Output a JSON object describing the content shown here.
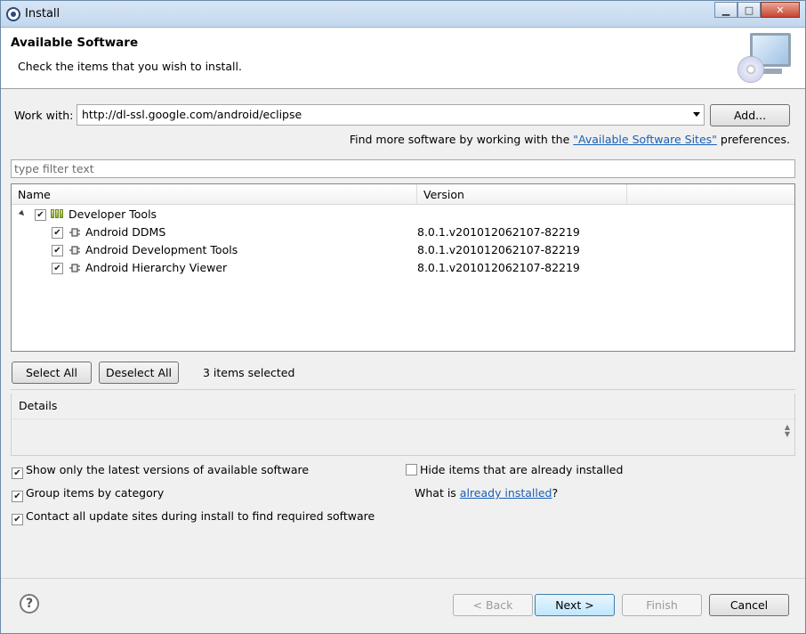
{
  "window": {
    "title": "Install"
  },
  "header": {
    "title": "Available Software",
    "subtitle": "Check the items that you wish to install."
  },
  "work_with": {
    "label": "Work with:",
    "value": "http://dl-ssl.google.com/android/eclipse",
    "add_button": "Add...",
    "hint_prefix": "Find more software by working with the ",
    "hint_link": "\"Available Software Sites\"",
    "hint_suffix": " preferences."
  },
  "filter": {
    "placeholder": "type filter text"
  },
  "table": {
    "columns": [
      "Name",
      "Version"
    ],
    "category": {
      "name": "Developer Tools",
      "checked": true
    },
    "items": [
      {
        "name": "Android DDMS",
        "version": "8.0.1.v201012062107-82219",
        "checked": true
      },
      {
        "name": "Android Development Tools",
        "version": "8.0.1.v201012062107-82219",
        "checked": true
      },
      {
        "name": "Android Hierarchy Viewer",
        "version": "8.0.1.v201012062107-82219",
        "checked": true
      }
    ]
  },
  "selection": {
    "select_all": "Select All",
    "deselect_all": "Deselect All",
    "status": "3 items selected"
  },
  "details": {
    "label": "Details"
  },
  "options": {
    "show_latest": {
      "label": "Show only the latest versions of available software",
      "checked": true
    },
    "group_by_category": {
      "label": "Group items by category",
      "checked": true
    },
    "contact_sites": {
      "label": "Contact all update sites during install to find required software",
      "checked": true
    },
    "hide_installed": {
      "label": "Hide items that are already installed",
      "checked": false
    },
    "what_is_prefix": "What is ",
    "what_is_link": "already installed",
    "what_is_suffix": "?"
  },
  "footer": {
    "back": "< Back",
    "next": "Next >",
    "finish": "Finish",
    "cancel": "Cancel"
  },
  "colors": {
    "link": "#1a5fb4",
    "default_button": "#3c7fb1"
  }
}
